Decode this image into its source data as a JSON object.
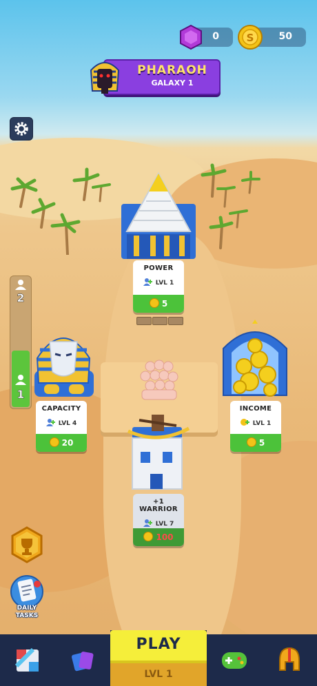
{
  "currency": {
    "gems": "0",
    "coins": "50",
    "gem_color": "#b23ad8",
    "coin_color": "#f3c318"
  },
  "level_banner": {
    "title": "PHARAOH",
    "subtitle": "GALAXY 1",
    "color": "#8a3fe0"
  },
  "settings": {
    "icon": "gear-icon"
  },
  "progress": {
    "top_marker": "2",
    "bottom_marker": "1",
    "fill_fraction": 0.45
  },
  "upgrades": {
    "power": {
      "title": "POWER",
      "level": "LVL 1",
      "cost": "5"
    },
    "capacity": {
      "title": "CAPACITY",
      "level": "LVL 4",
      "cost": "20"
    },
    "income": {
      "title": "INCOME",
      "level": "LVL 1",
      "cost": "5"
    },
    "warrior": {
      "title": "+1 WARRIOR",
      "level": "LVL 7",
      "cost": "100"
    }
  },
  "side_buttons": {
    "trophy": {
      "icon": "trophy-icon"
    },
    "daily_tasks": {
      "label": "DAILY TASKS",
      "icon": "clipboard-icon"
    }
  },
  "bottom_nav": {
    "play_label": "PLAY",
    "play_level": "LVL 1",
    "items": [
      {
        "icon": "map-icon"
      },
      {
        "icon": "cards-icon"
      },
      {
        "icon": "gamepad-icon"
      },
      {
        "icon": "helmet-icon"
      }
    ]
  }
}
